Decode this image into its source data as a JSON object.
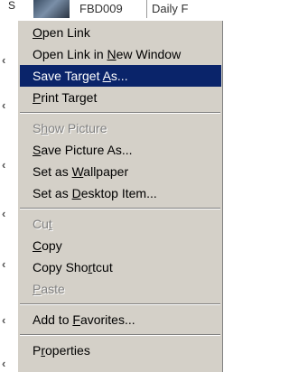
{
  "background": {
    "row_cells": [
      "FBD009",
      "Daily F"
    ],
    "clip_glyph": "S"
  },
  "menu": {
    "items": [
      {
        "parts": [
          "",
          "O",
          "pen Link"
        ],
        "enabled": true,
        "highlighted": false
      },
      {
        "parts": [
          "Open Link in ",
          "N",
          "ew Window"
        ],
        "enabled": true,
        "highlighted": false
      },
      {
        "parts": [
          "Save Target ",
          "A",
          "s..."
        ],
        "enabled": true,
        "highlighted": true
      },
      {
        "parts": [
          "",
          "P",
          "rint Target"
        ],
        "enabled": true,
        "highlighted": false
      },
      {
        "separator": true
      },
      {
        "parts": [
          "S",
          "h",
          "ow Picture"
        ],
        "enabled": false,
        "highlighted": false
      },
      {
        "parts": [
          "",
          "S",
          "ave Picture As..."
        ],
        "enabled": true,
        "highlighted": false
      },
      {
        "parts": [
          "Set as ",
          "W",
          "allpaper"
        ],
        "enabled": true,
        "highlighted": false
      },
      {
        "parts": [
          "Set as ",
          "D",
          "esktop Item..."
        ],
        "enabled": true,
        "highlighted": false
      },
      {
        "separator": true
      },
      {
        "parts": [
          "Cu",
          "t",
          ""
        ],
        "enabled": false,
        "highlighted": false
      },
      {
        "parts": [
          "",
          "C",
          "opy"
        ],
        "enabled": true,
        "highlighted": false
      },
      {
        "parts": [
          "Copy Sho",
          "r",
          "tcut"
        ],
        "enabled": true,
        "highlighted": false
      },
      {
        "parts": [
          "",
          "P",
          "aste"
        ],
        "enabled": false,
        "highlighted": false
      },
      {
        "separator": true
      },
      {
        "parts": [
          "Add to ",
          "F",
          "avorites..."
        ],
        "enabled": true,
        "highlighted": false
      },
      {
        "separator": true
      },
      {
        "parts": [
          "P",
          "r",
          "operties"
        ],
        "enabled": true,
        "highlighted": false
      }
    ]
  },
  "colors": {
    "menu_bg": "#d4d0c8",
    "highlight_bg": "#0a246a",
    "highlight_text": "#ffffff",
    "disabled_text": "#808080"
  }
}
